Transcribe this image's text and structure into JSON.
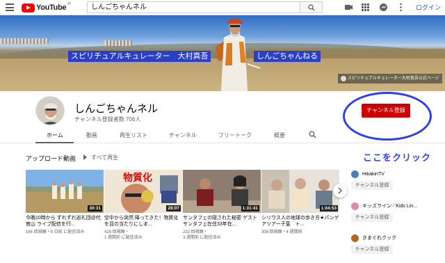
{
  "header": {
    "logo_text": "YouTube",
    "region": "JP",
    "search_value": "しんごちゃんネル",
    "login_label": "ログイン"
  },
  "banner": {
    "text_left": "スピリチュアルキュレーター　大村真吾",
    "text_right": "しんごちゃんねる",
    "link_label": "スピリチュアルキュレーター大村真吾公式ページ"
  },
  "channel": {
    "name": "しんごちゃんネル",
    "subscribers": "チャンネル登録者数 706人",
    "subscribe_label": "チャンネル登録",
    "annotation": "ここをクリック"
  },
  "tabs": [
    {
      "label": "ホーム"
    },
    {
      "label": "動画"
    },
    {
      "label": "再生リスト"
    },
    {
      "label": "チャンネル"
    },
    {
      "label": "フリートーク"
    },
    {
      "label": "概要"
    }
  ],
  "uploads": {
    "title": "アップロード動画",
    "play_all": "すべて再生",
    "videos": [
      {
        "title": "今晩10時から ずれずれ巡礼団@代官山 ライブ配信を行...",
        "views": "164 回視聴・6 日前 に配信済み",
        "duration": "30:31"
      },
      {
        "title": "空中から突然 降ってきた！物質化を目の当たりにしま...",
        "views": "428 回視聴・",
        "views2": "1 週間前 に配信済み",
        "duration": "28:07",
        "overlay": "物質化"
      },
      {
        "title": "サンタフェの隠された秘密 ゲストサンタフェ在住33年在...",
        "views": "233 回視聴・",
        "views2": "3 週間前 に配信済み",
        "duration": "1:31:41"
      },
      {
        "title": "シリウス人の地球の歩き方★パンゲアツアー子葉　ト...",
        "views": "308 回視聴・4 週間前",
        "duration": "1:04:53"
      }
    ]
  },
  "side_channels": [
    {
      "name": "HikakinTV",
      "button": "チャンネル登録",
      "color": "#4a7fbf"
    },
    {
      "name": "キッズライン♡Kids Lin...",
      "button": "チャンネル登録",
      "color": "#e08aa6"
    },
    {
      "name": "きまぐれクック",
      "button": "チャンネル登録",
      "color": "#b5651d"
    }
  ],
  "colors": {
    "subscribe_red": "#cc0000",
    "annotation_blue": "#2a3ff0",
    "banner_label_bg": "#2a3fc6"
  }
}
